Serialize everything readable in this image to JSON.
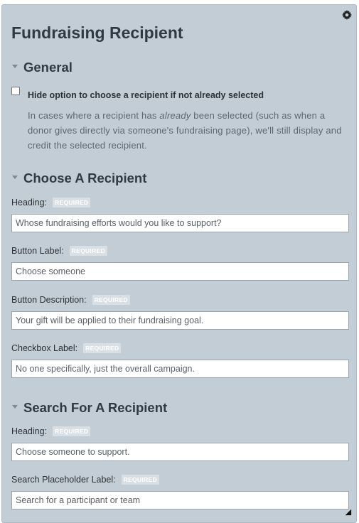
{
  "panel": {
    "title": "Fundraising Recipient",
    "settings_icon": "gear-icon"
  },
  "general": {
    "heading": "General",
    "checkbox_label": "Hide option to choose a recipient if not already selected",
    "checkbox_checked": false,
    "description_before": "In cases where a recipient has ",
    "description_em": "already",
    "description_after": " been selected (such as when a donor gives directly via someone's fundraising page), we'll still display and credit the selected recipient."
  },
  "choose": {
    "heading": "Choose A Recipient",
    "fields": [
      {
        "label": "Heading:",
        "badge": "REQUIRED",
        "value": "Whose fundraising efforts would you like to support?"
      },
      {
        "label": "Button Label:",
        "badge": "REQUIRED",
        "value": "Choose someone"
      },
      {
        "label": "Button Description:",
        "badge": "REQUIRED",
        "value": "Your gift will be applied to their fundraising goal."
      },
      {
        "label": "Checkbox Label:",
        "badge": "REQUIRED",
        "value": "No one specifically, just the overall campaign."
      }
    ]
  },
  "search": {
    "heading": "Search For A Recipient",
    "fields": [
      {
        "label": "Heading:",
        "badge": "REQUIRED",
        "value": "Choose someone to support."
      },
      {
        "label": "Search Placeholder Label:",
        "badge": "REQUIRED",
        "value": "Search for a participant or team"
      }
    ]
  }
}
